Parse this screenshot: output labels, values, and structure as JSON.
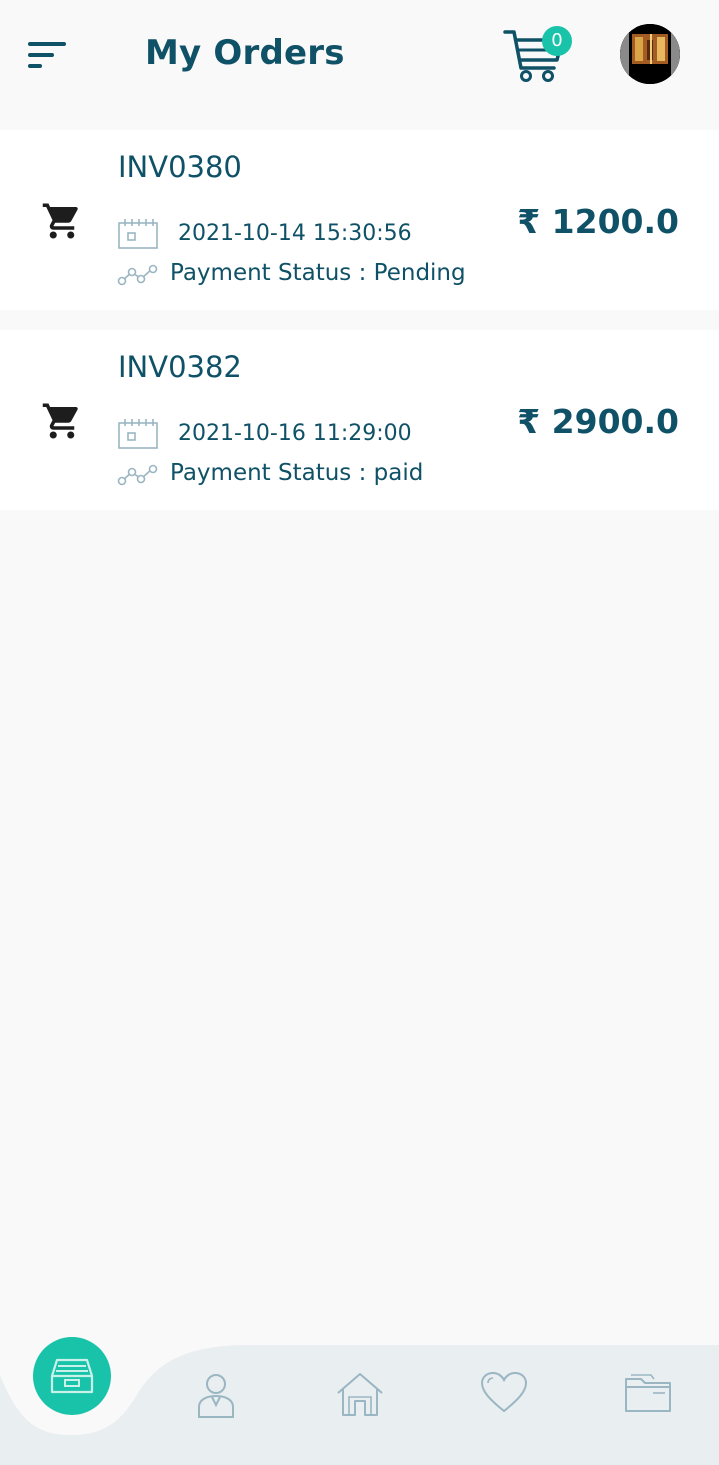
{
  "header": {
    "title": "My Orders",
    "cart_count": "0"
  },
  "orders": [
    {
      "invoice": "INV0380",
      "date": "2021-10-14 15:30:56",
      "payment_status": "Payment Status : Pending",
      "amount": "₹ 1200.0"
    },
    {
      "invoice": "INV0382",
      "date": "2021-10-16 11:29:00",
      "payment_status": "Payment Status : paid",
      "amount": "₹ 2900.0"
    }
  ],
  "bottom_nav": {
    "active": "orders",
    "items": [
      "orders-icon",
      "profile-icon",
      "home-icon",
      "heart-icon",
      "folder-icon"
    ]
  },
  "colors": {
    "primary": "#0f5166",
    "accent": "#18c3a9",
    "icon_muted": "#9ab6c2",
    "nav_bg": "#e9eef0"
  }
}
